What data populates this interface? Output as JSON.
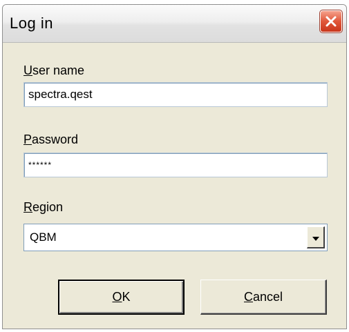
{
  "window": {
    "title": "Log in"
  },
  "form": {
    "username": {
      "label_access_key": "U",
      "label_rest": "ser name",
      "value": "spectra.qest"
    },
    "password": {
      "label_access_key": "P",
      "label_rest": "assword",
      "value": "******"
    },
    "region": {
      "label_access_key": "R",
      "label_rest": "egion",
      "selected": "QBM"
    }
  },
  "buttons": {
    "ok": {
      "access_key": "O",
      "rest": "K"
    },
    "cancel": {
      "access_key": "C",
      "rest": "ancel"
    }
  },
  "icons": {
    "close": "close-icon",
    "dropdown": "chevron-down-icon"
  },
  "colors": {
    "dialog_bg": "#ece9d8",
    "close_button": "#e0573a",
    "field_border": "#7f9db9"
  }
}
